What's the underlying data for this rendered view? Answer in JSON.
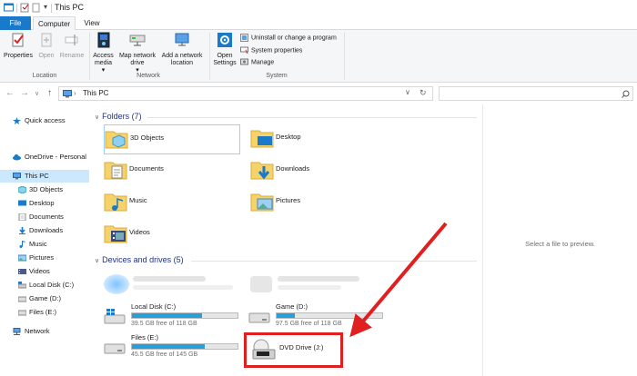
{
  "window": {
    "title": "This PC"
  },
  "ribbon_tabs": {
    "file": "File",
    "computer": "Computer",
    "view": "View"
  },
  "ribbon": {
    "location": {
      "properties": "Properties",
      "open": "Open",
      "rename": "Rename",
      "label": "Location"
    },
    "network": {
      "access_media": "Access media",
      "access_media_arrow": "▾",
      "map_drive": "Map network drive",
      "map_drive_arrow": "▾",
      "add_location": "Add a network location",
      "label": "Network"
    },
    "system": {
      "open_settings": "Open Settings",
      "uninstall": "Uninstall or change a program",
      "system_properties": "System properties",
      "manage": "Manage",
      "label": "System"
    }
  },
  "address": {
    "path": "This PC",
    "refresh": "↻"
  },
  "nav": {
    "back": "←",
    "forward": "→",
    "down": "∨",
    "up": "↑",
    "items": [
      {
        "label": "Quick access"
      },
      {
        "label": "OneDrive - Personal"
      },
      {
        "label": "This PC"
      },
      {
        "label": "3D Objects"
      },
      {
        "label": "Desktop"
      },
      {
        "label": "Documents"
      },
      {
        "label": "Downloads"
      },
      {
        "label": "Music"
      },
      {
        "label": "Pictures"
      },
      {
        "label": "Videos"
      },
      {
        "label": "Local Disk (C:)"
      },
      {
        "label": "Game (D:)"
      },
      {
        "label": "Files (E:)"
      },
      {
        "label": "Network"
      }
    ]
  },
  "folders": {
    "heading": "Folders (7)",
    "items": [
      {
        "label": "3D Objects",
        "icon": "3d-objects-folder-icon"
      },
      {
        "label": "Desktop",
        "icon": "desktop-folder-icon"
      },
      {
        "label": "Documents",
        "icon": "documents-folder-icon"
      },
      {
        "label": "Downloads",
        "icon": "downloads-folder-icon"
      },
      {
        "label": "Music",
        "icon": "music-folder-icon"
      },
      {
        "label": "Pictures",
        "icon": "pictures-folder-icon"
      },
      {
        "label": "Videos",
        "icon": "videos-folder-icon"
      }
    ]
  },
  "drives": {
    "heading": "Devices and drives (5)",
    "items": [
      {
        "name": "Local Disk (C:)",
        "free": "39.5 GB free of 118 GB",
        "used_fraction": 0.665
      },
      {
        "name": "Game (D:)",
        "free": "97.5 GB free of 118 GB",
        "used_fraction": 0.174
      },
      {
        "name": "Files (E:)",
        "free": "45.5 GB free of 145 GB",
        "used_fraction": 0.686
      },
      {
        "name": "DVD Drive (J:)"
      }
    ]
  },
  "preview": {
    "text": "Select a file to preview."
  },
  "colors": {
    "accent": "#1979ca",
    "highlight": "#e02020",
    "drive_bar": "#26a0da",
    "selection": "#cce8ff"
  }
}
